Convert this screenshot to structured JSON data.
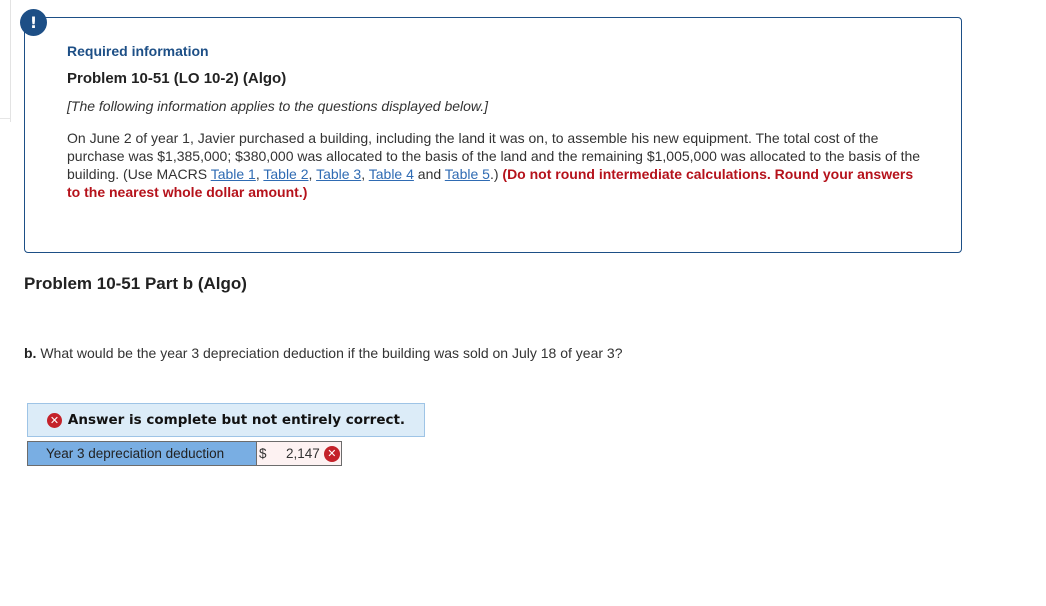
{
  "info_box": {
    "icon": "exclamation-icon",
    "icon_glyph": "!",
    "required_label": "Required information",
    "problem_title": "Problem 10-51 (LO 10-2) (Algo)",
    "note": "[The following information applies to the questions displayed below.]",
    "paragraph_part1": "On June 2 of year 1, Javier purchased a building, including the land it was on, to assemble his new equipment. The total cost of the purchase was $1,385,000; $380,000 was allocated to the basis of the land and the remaining $1,005,000 was allocated to the basis of the building. (Use MACRS ",
    "links": [
      "Table 1",
      "Table 2",
      "Table 3",
      "Table 4",
      "Table 5"
    ],
    "sep_comma": ", ",
    "sep_and": " and ",
    "paragraph_after_links": ".) ",
    "instruction": "(Do not round intermediate calculations. Round your answers to the nearest whole dollar amount.)"
  },
  "part": {
    "title": "Problem 10-51 Part b (Algo)",
    "question_label": "b.",
    "question_text": " What would be the year 3 depreciation deduction if the building was sold on July 18 of year 3?"
  },
  "answer": {
    "status_icon": "x-circle-icon",
    "status_glyph": "✕",
    "status_text": "Answer is complete but not entirely correct.",
    "rows": [
      {
        "label": "Year 3 depreciation deduction",
        "currency": "$",
        "value": "2,147",
        "result": "incorrect"
      }
    ]
  },
  "colors": {
    "brand_blue": "#1d4f86",
    "link_blue": "#2f6bb3",
    "instruction_red": "#b5121b",
    "error_red": "#c4222a",
    "label_cell_blue": "#79aee3",
    "banner_bg": "#dcecf8"
  }
}
